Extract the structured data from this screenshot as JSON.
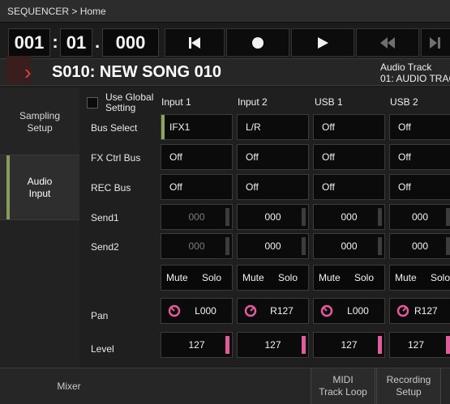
{
  "title_bar": {
    "text": "SEQUENCER > Home"
  },
  "locator": {
    "measure": "001",
    "beat": "01",
    "tick": "000",
    "sep1": ":",
    "sep2": "."
  },
  "song": {
    "arrow": "›",
    "name": "S010: NEW SONG 010",
    "track_type": "Audio Track",
    "track_name": "01: AUDIO TRAC"
  },
  "left_tabs": [
    {
      "label": "Sampling\nSetup"
    },
    {
      "label": "Audio\nInput"
    }
  ],
  "global": {
    "use_global_label": "Use Global\nSetting"
  },
  "columns": [
    "Input 1",
    "Input 2",
    "USB 1",
    "USB 2"
  ],
  "row_labels": {
    "bus_select": "Bus Select",
    "fx_ctrl_bus": "FX Ctrl Bus",
    "rec_bus": "REC Bus",
    "send1": "Send1",
    "send2": "Send2",
    "pan": "Pan",
    "level": "Level"
  },
  "bus_select": [
    "IFX1",
    "L/R",
    "Off",
    "Off"
  ],
  "fx_ctrl_bus": [
    "Off",
    "Off",
    "Off",
    "Off"
  ],
  "rec_bus": [
    "Off",
    "Off",
    "Off",
    "Off"
  ],
  "send1": [
    "000",
    "000",
    "000",
    "000"
  ],
  "send2": [
    "000",
    "000",
    "000",
    "000"
  ],
  "mute_label": "Mute",
  "solo_label": "Solo",
  "pan": [
    "L000",
    "R127",
    "L000",
    "R127"
  ],
  "level": [
    "127",
    "127",
    "127",
    "127"
  ],
  "bottom_tabs": [
    "Mixer",
    "MIDI\nTrack Loop",
    "Recording\nSetup"
  ],
  "colors": {
    "level_bar": "#e25b9c",
    "selected_indicator": "#8fa65a",
    "song_arrow": "#e04040"
  }
}
